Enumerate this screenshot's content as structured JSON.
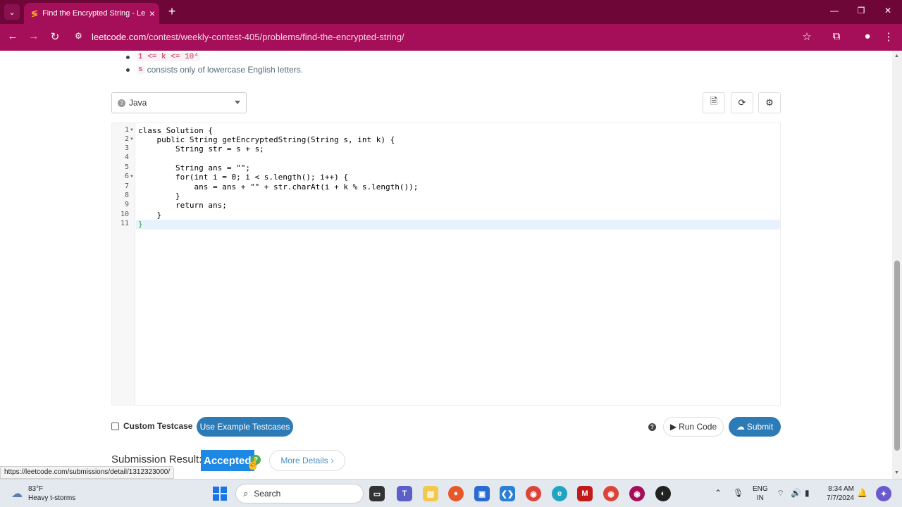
{
  "browser": {
    "tab_title": "Find the Encrypted String - LeetCode",
    "url_domain": "leetcode.com",
    "url_path": "/contest/weekly-contest-405/problems/find-the-encrypted-string/",
    "theme_color": "#a50e58"
  },
  "constraints": [
    {
      "code": "1 <= k <= 10⁴",
      "text": ""
    },
    {
      "code": "s",
      "text": "consists only of lowercase English letters."
    }
  ],
  "editor": {
    "language": "Java",
    "toolbar": [
      "document-icon",
      "refresh-icon",
      "settings-icon"
    ],
    "line_numbers": [
      "1",
      "2",
      "3",
      "4",
      "5",
      "6",
      "7",
      "8",
      "9",
      "10",
      "11"
    ],
    "lines": [
      "class Solution {",
      "    public String getEncryptedString(String s, int k) {",
      "        String str = s + s;",
      "",
      "        String ans = \"\";",
      "        for(int i = 0; i < s.length(); i++) {",
      "            ans = ans + \"\" + str.charAt(i + k % s.length());",
      "        }",
      "        return ans;",
      "    }",
      "}"
    ]
  },
  "actions": {
    "custom_testcase": "Custom Testcase",
    "use_example": "Use Example Testcases",
    "help": "?",
    "run_code": "Run Code",
    "submit": "Submit"
  },
  "result": {
    "label": "Submission Result:",
    "status": "Accepted",
    "more_details": "More Details",
    "status_color": "#1e88e5"
  },
  "status_url": "https://leetcode.com/submissions/detail/1312323000/",
  "taskbar": {
    "temperature": "83°F",
    "weather": "Heavy t-storms",
    "search": "Search",
    "lang_top": "ENG",
    "lang_bottom": "IN",
    "time": "8:34 AM",
    "date": "7/7/2024"
  }
}
